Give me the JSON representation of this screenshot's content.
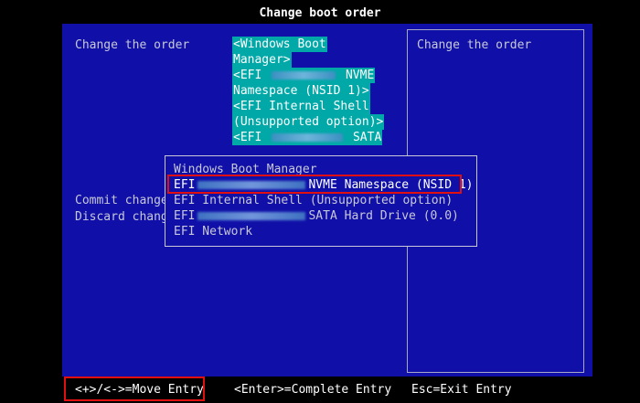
{
  "window": {
    "title": "Change boot order"
  },
  "left_labels": {
    "change_order": "Change the order",
    "commit": "Commit change",
    "discard": "Discard chang"
  },
  "order_list": {
    "lines": [
      "<Windows Boot",
      "Manager>",
      "<EFI ",
      " NVME",
      "Namespace (NSID 1)>",
      "<EFI Internal Shell",
      "(Unsupported option)>",
      "<EFI ",
      " SATA"
    ]
  },
  "help": {
    "title": "Change the order"
  },
  "popup": {
    "items": {
      "windows": "Windows Boot Manager",
      "nvme_prefix": "EFI",
      "nvme_suffix": "NVME Namespace (NSID 1)",
      "shell": "EFI Internal Shell (Unsupported option)",
      "sata_prefix": "EFI",
      "sata_suffix": "SATA Hard Drive (0.0)",
      "network": "EFI Network"
    }
  },
  "footer": {
    "move": "<+>/<->=Move Entry",
    "enter": "<Enter>=Complete Entry",
    "esc": "Esc=Exit Entry"
  },
  "colors": {
    "background": "#1010a8",
    "highlight": "#00a8a8",
    "annotation": "#e01010"
  }
}
